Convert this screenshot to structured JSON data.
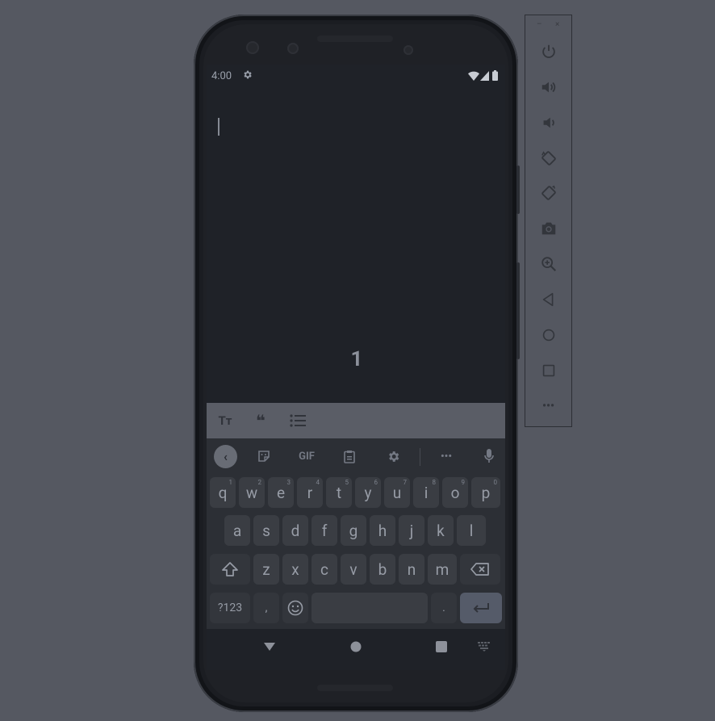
{
  "status_bar": {
    "time": "4:00",
    "settings_icon": "gear-icon",
    "wifi_icon": "wifi-icon",
    "signal_icon": "signal-icon",
    "battery_icon": "battery-icon"
  },
  "document": {
    "page_number": "1"
  },
  "format_toolbar": {
    "items": [
      {
        "name": "text-format-icon",
        "glyph": "Tт"
      },
      {
        "name": "quote-icon",
        "glyph": "❝"
      },
      {
        "name": "bulleted-list-icon",
        "glyph": "☰"
      }
    ]
  },
  "keyboard": {
    "suggestion_bar": {
      "gif_label": "GIF",
      "more_label": "•••"
    },
    "row1": [
      {
        "key": "q",
        "hint": "1"
      },
      {
        "key": "w",
        "hint": "2"
      },
      {
        "key": "e",
        "hint": "3"
      },
      {
        "key": "r",
        "hint": "4"
      },
      {
        "key": "t",
        "hint": "5"
      },
      {
        "key": "y",
        "hint": "6"
      },
      {
        "key": "u",
        "hint": "7"
      },
      {
        "key": "i",
        "hint": "8"
      },
      {
        "key": "o",
        "hint": "9"
      },
      {
        "key": "p",
        "hint": "0"
      }
    ],
    "row2": [
      "a",
      "s",
      "d",
      "f",
      "g",
      "h",
      "j",
      "k",
      "l"
    ],
    "row3": [
      "z",
      "x",
      "c",
      "v",
      "b",
      "n",
      "m"
    ],
    "symbols_label": "?123",
    "comma_label": ",",
    "period_label": "."
  },
  "emulator_panel": {
    "minimize_label": "–",
    "close_label": "×",
    "tools": [
      "power-icon",
      "volume-up-icon",
      "volume-down-icon",
      "rotate-left-icon",
      "rotate-right-icon",
      "screenshot-camera-icon",
      "zoom-icon",
      "back-icon",
      "home-icon",
      "overview-icon",
      "more-icon"
    ],
    "more_label": "•••"
  },
  "colors": {
    "backdrop": "#555861",
    "screen": "#1f2228",
    "keyboard": "#2c2f35",
    "key": "#3a3d43",
    "enter_key": "#555b69"
  }
}
